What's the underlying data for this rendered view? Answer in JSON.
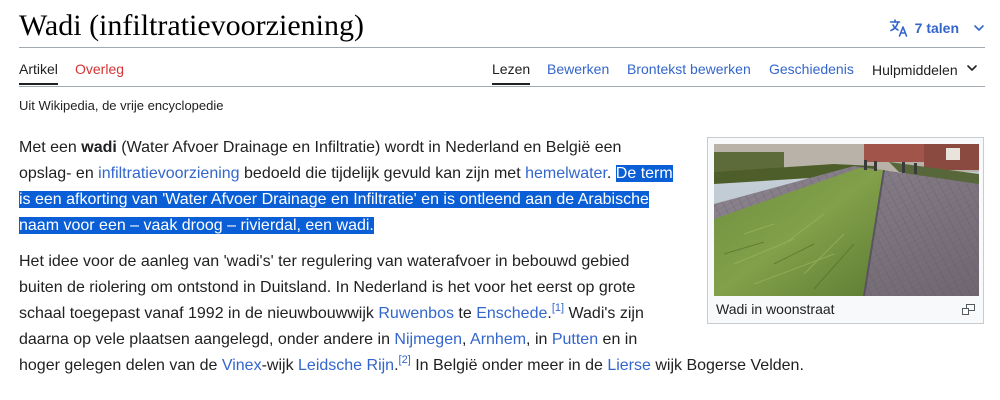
{
  "header": {
    "title": "Wadi (infiltratievoorziening)",
    "languages_label": "7 talen"
  },
  "tabs": {
    "article": "Artikel",
    "talk": "Overleg",
    "read": "Lezen",
    "edit": "Bewerken",
    "edit_source": "Brontekst bewerken",
    "history": "Geschiedenis",
    "tools": "Hulpmiddelen"
  },
  "tagline": "Uit Wikipedia, de vrije encyclopedie",
  "paragraph1": {
    "l1_a": "Met een ",
    "l1_b": "wadi",
    "l1_c": " (Water Afvoer Drainage en Infiltratie) wordt in Nederland en België een",
    "l2_a": "opslag- en ",
    "l2_link1": "infiltratievoorziening",
    "l2_b": " bedoeld die tijdelijk gevuld kan zijn met ",
    "l2_link2": "hemelwater",
    "l2_c": ". ",
    "l2_sel": "De term",
    "l3_sel": "is een afkorting van 'Water Afvoer Drainage en Infiltratie' en is ontleend aan de Arabische",
    "l4_sel": "naam voor een – vaak droog – rivierdal, een wadi."
  },
  "paragraph2": {
    "l1": "Het idee voor de aanleg van 'wadi's' ter regulering van waterafvoer in bebouwd gebied",
    "l2": "buiten de riolering om ontstond in Duitsland. In Nederland is het voor het eerst op grote",
    "l3_a": "schaal toegepast vanaf 1992 in de nieuwbouwwijk ",
    "l3_link1": "Ruwenbos",
    "l3_b": " te ",
    "l3_link2": "Enschede",
    "l3_c": ".",
    "l3_ref": "[1]",
    "l3_d": " Wadi's zijn",
    "l4_a": "daarna op vele plaatsen aangelegd, onder andere in ",
    "l4_link1": "Nijmegen",
    "l4_b": ", ",
    "l4_link2": "Arnhem",
    "l4_c": ", in ",
    "l4_link3": "Putten",
    "l4_d": " en in",
    "l5_a": "hoger gelegen delen van de ",
    "l5_link1": "Vinex",
    "l5_b": "-wijk ",
    "l5_link2": "Leidsche Rijn",
    "l5_c": ".",
    "l5_ref": "[2]",
    "l5_d": " In België onder meer in de ",
    "l5_link3": "Lierse",
    "l5_e": " wijk Bogerse Velden."
  },
  "figure": {
    "caption": "Wadi in woonstraat"
  },
  "colors": {
    "link": "#3366cc",
    "red_link": "#d73333",
    "text": "#202122",
    "selection": "#0a5fd6",
    "border": "#a2a9b1"
  },
  "icons": {
    "language": "translate-icon",
    "dropdown": "chevron-down-icon",
    "enlarge": "magnify-icon"
  }
}
